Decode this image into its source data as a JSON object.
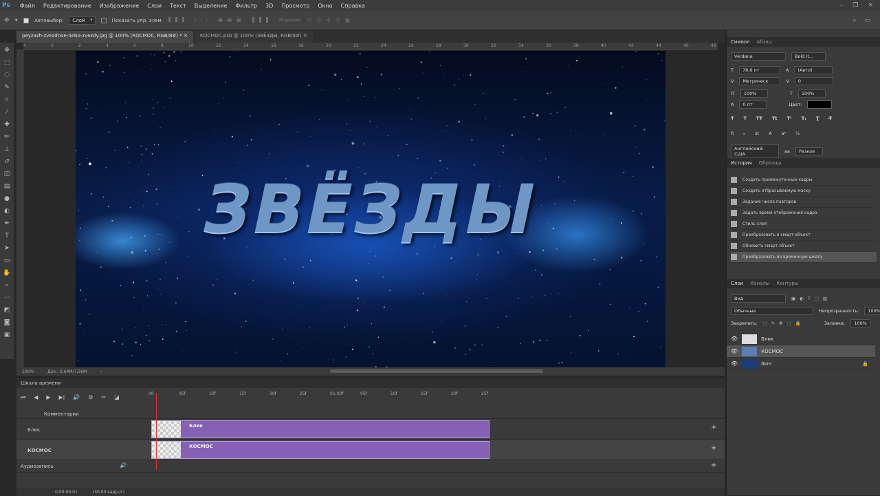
{
  "menu": {
    "logo": "Ps",
    "items": [
      "Файл",
      "Редактирование",
      "Изображение",
      "Слои",
      "Текст",
      "Выделение",
      "Фильтр",
      "3D",
      "Просмотр",
      "Окно",
      "Справка"
    ]
  },
  "options": {
    "autoselect_label": "Автовыбор:",
    "autoselect_value": "Слой",
    "show_controls_label": "Показать упр. элем.",
    "mode_3d": "3D-режим:"
  },
  "doc_tabs": [
    {
      "label": "peyzazh-zvezdnoe-nebo-zvezdy.jpg @ 100% (КОСМОС, RGB/8#) *"
    },
    {
      "label": "КОСМОС.psb @ 100% (ЗВЁЗДЫ, RGB/8#)"
    }
  ],
  "ruler_ticks": [
    "4",
    "0",
    "2",
    "4",
    "6",
    "8",
    "10",
    "12",
    "14",
    "16",
    "18",
    "20",
    "22",
    "24",
    "26",
    "28",
    "30",
    "32",
    "34",
    "36",
    "38",
    "40",
    "42",
    "44",
    "46",
    "48"
  ],
  "canvas": {
    "title": "ЗВЁЗДЫ"
  },
  "status": {
    "zoom": "100%",
    "doc": "Док.: 2,64М/7,56М"
  },
  "timeline": {
    "title": "Шкала времени",
    "ruler": [
      "00",
      "05f",
      "10f",
      "15f",
      "20f",
      "25f",
      "01:00f",
      "05f",
      "10f",
      "15f",
      "20f",
      "25f"
    ],
    "comments_label": "Комментарии",
    "tracks": [
      {
        "name": "Блик",
        "clip_label": "Блик"
      },
      {
        "name": "КОСМОС",
        "clip_label": "КОСМОС"
      }
    ],
    "audio_label": "Аудиозапись",
    "time": "0:00:00:01",
    "fps": "(30,00 кадр./с)"
  },
  "char_panel": {
    "tabs": [
      "Символ",
      "Абзац"
    ],
    "font": "Verdana",
    "style": "Bold It...",
    "size": "78,6 пт",
    "leading": "(Авто)",
    "kerning": "Метрическ",
    "tracking": "0",
    "vscale": "100%",
    "hscale": "100%",
    "baseline": "0 пт",
    "color_label": "Цвет:",
    "language": "Английский: США",
    "aa": "Резкое"
  },
  "history": {
    "tabs": [
      "История",
      "Образцы"
    ],
    "items": [
      "Создать промежуточные кадры",
      "Создать отбрасываемую маску",
      "Задание числа повторов",
      "Задать время отображения кадра",
      "Стиль слоя",
      "Преобразовать в смарт-объект",
      "Обновить смарт-объект",
      "Преобразовать во временную шкалу"
    ]
  },
  "layers": {
    "tabs": [
      "Слои",
      "Каналы",
      "Контуры"
    ],
    "filter": "Вид",
    "blend": "Обычные",
    "opacity_label": "Непрозрачность:",
    "opacity": "100%",
    "lock_label": "Закрепить:",
    "fill_label": "Заливка:",
    "fill": "100%",
    "items": [
      {
        "name": "Блик"
      },
      {
        "name": "КОСМОС"
      },
      {
        "name": "Фон"
      }
    ]
  }
}
